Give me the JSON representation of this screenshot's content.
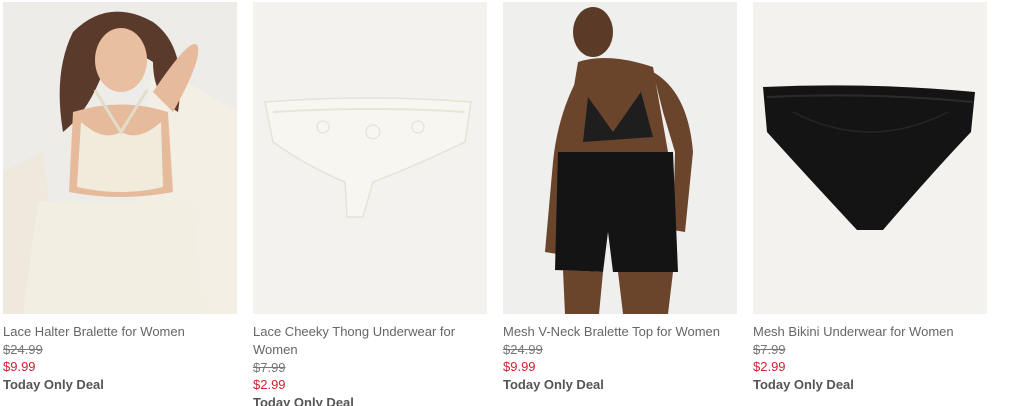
{
  "colors": {
    "sale_price": "#d2212e",
    "product_name": "#666666",
    "original_price": "#777777",
    "image_background": "#f2f1ef"
  },
  "products": [
    {
      "name": "Lace Halter Bralette for Women",
      "original_price": "$24.99",
      "sale_price": "$9.99",
      "deal": "Today Only Deal"
    },
    {
      "name": "Lace Cheeky Thong Underwear for Women",
      "original_price": "$7.99",
      "sale_price": "$2.99",
      "deal": "Today Only Deal"
    },
    {
      "name": "Mesh V-Neck Bralette Top for Women",
      "original_price": "$24.99",
      "sale_price": "$9.99",
      "deal": "Today Only Deal"
    },
    {
      "name": "Mesh Bikini Underwear for Women",
      "original_price": "$7.99",
      "sale_price": "$2.99",
      "deal": "Today Only Deal"
    }
  ]
}
